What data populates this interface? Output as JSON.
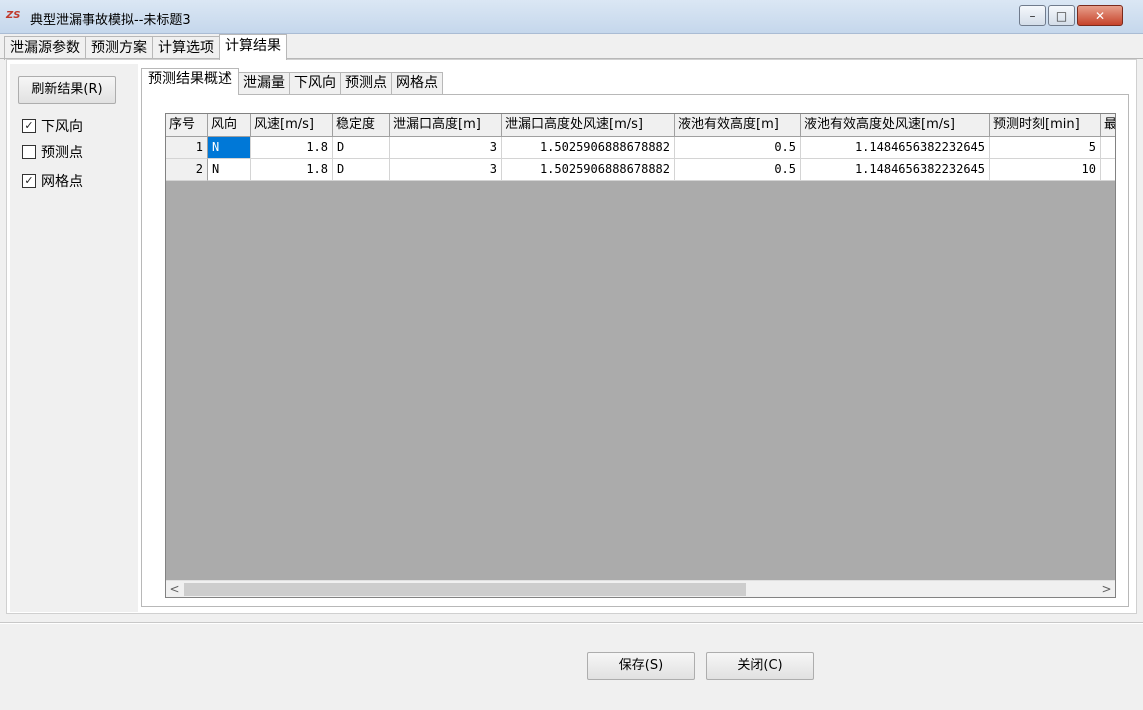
{
  "window": {
    "title": "典型泄漏事故模拟--未标题3",
    "app_icon_text": "ZS"
  },
  "top_tabs": [
    {
      "label": "泄漏源参数"
    },
    {
      "label": "预测方案"
    },
    {
      "label": "计算选项"
    },
    {
      "label": "计算结果"
    }
  ],
  "side": {
    "refresh_label": "刷新结果(R)",
    "checkboxes": [
      {
        "label": "下风向",
        "checked": true
      },
      {
        "label": "预测点",
        "checked": false
      },
      {
        "label": "网格点",
        "checked": true
      }
    ]
  },
  "inner_tabs": [
    {
      "label": "预测结果概述"
    },
    {
      "label": "泄漏量"
    },
    {
      "label": "下风向"
    },
    {
      "label": "预测点"
    },
    {
      "label": "网格点"
    }
  ],
  "table": {
    "columns": [
      "序号",
      "风向",
      "风速[m/s]",
      "稳定度",
      "泄漏口高度[m]",
      "泄漏口高度处风速[m/s]",
      "液池有效高度[m]",
      "液池有效高度处风速[m/s]",
      "预测时刻[min]",
      "最"
    ],
    "rows": [
      [
        "1",
        "N",
        "1.8",
        "D",
        "3",
        "1.5025906888678882",
        "0.5",
        "1.1484656382232645",
        "5"
      ],
      [
        "2",
        "N",
        "1.8",
        "D",
        "3",
        "1.5025906888678882",
        "0.5",
        "1.1484656382232645",
        "10"
      ]
    ]
  },
  "scroll": {
    "left_arrow": "<",
    "right_arrow": ">"
  },
  "buttons": {
    "save_label": "保存(S)",
    "close_label": "关闭(C)"
  }
}
